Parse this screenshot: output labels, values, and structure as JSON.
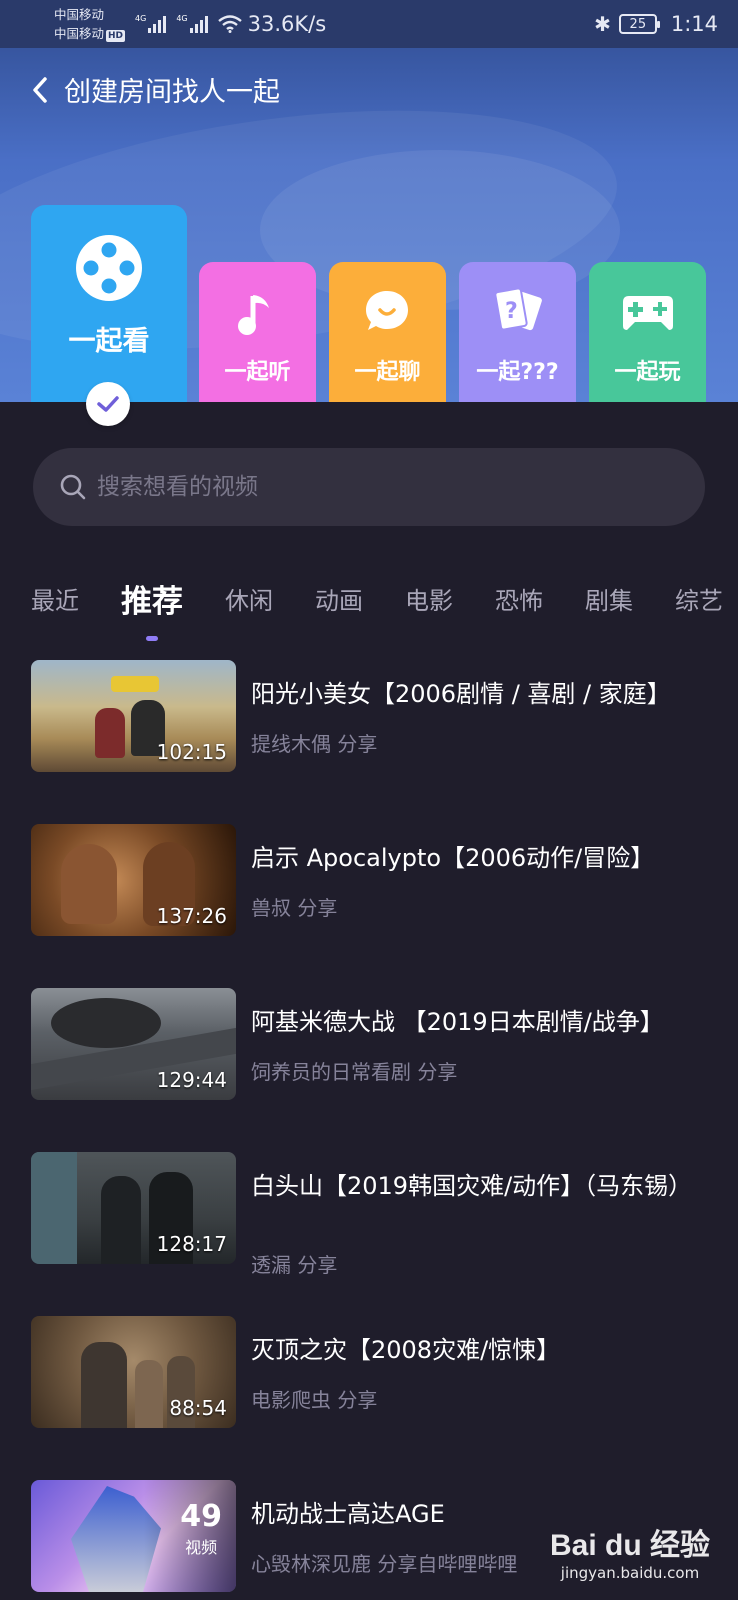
{
  "status_bar": {
    "carrier_1": "中国移动",
    "carrier_2": "中国移动",
    "hd_badge": "HD",
    "signal_label": "4G",
    "net_speed": "33.6K/s",
    "battery": "25",
    "time": "1:14"
  },
  "header": {
    "title": "创建房间找人一起",
    "back_icon": "chevron-left-icon"
  },
  "categories": [
    {
      "label": "一起看",
      "icon": "film-reel-icon",
      "color": "#2fa6f1",
      "selected": true
    },
    {
      "label": "一起听",
      "icon": "music-note-icon",
      "color": "#f36fe3"
    },
    {
      "label": "一起聊",
      "icon": "chat-bubble-icon",
      "color": "#fcae3a"
    },
    {
      "label": "一起???",
      "icon": "question-cards-icon",
      "color": "#9d8ff6"
    },
    {
      "label": "一起玩",
      "icon": "gamepad-icon",
      "color": "#48c79a"
    }
  ],
  "search": {
    "placeholder": "搜索想看的视频"
  },
  "tabs": [
    "最近",
    "推荐",
    "休闲",
    "动画",
    "电影",
    "恐怖",
    "剧集",
    "综艺"
  ],
  "active_tab": "推荐",
  "videos": [
    {
      "title": "阳光小美女【2006剧情 / 喜剧 / 家庭】",
      "uploader": "提线木偶 分享",
      "duration": "102:15"
    },
    {
      "title": "启示 Apocalypto【2006动作/冒险】",
      "uploader": "兽叔 分享",
      "duration": "137:26"
    },
    {
      "title": "阿基米德大战 【2019日本剧情/战争】",
      "uploader": "饲养员的日常看剧 分享",
      "duration": "129:44"
    },
    {
      "title": "白头山【2019韩国灾难/动作】（马东锡）",
      "uploader": "透漏 分享",
      "duration": "128:17"
    },
    {
      "title": "灭顶之灾【2008灾难/惊悚】",
      "uploader": "电影爬虫 分享",
      "duration": "88:54"
    },
    {
      "title": "机动战士高达AGE",
      "uploader": "心毁林深见鹿 分享自哔哩哔哩",
      "count": "49",
      "count_label": "视频"
    }
  ],
  "watermark": {
    "brand": "Bai du 经验",
    "url": "jingyan.baidu.com"
  }
}
